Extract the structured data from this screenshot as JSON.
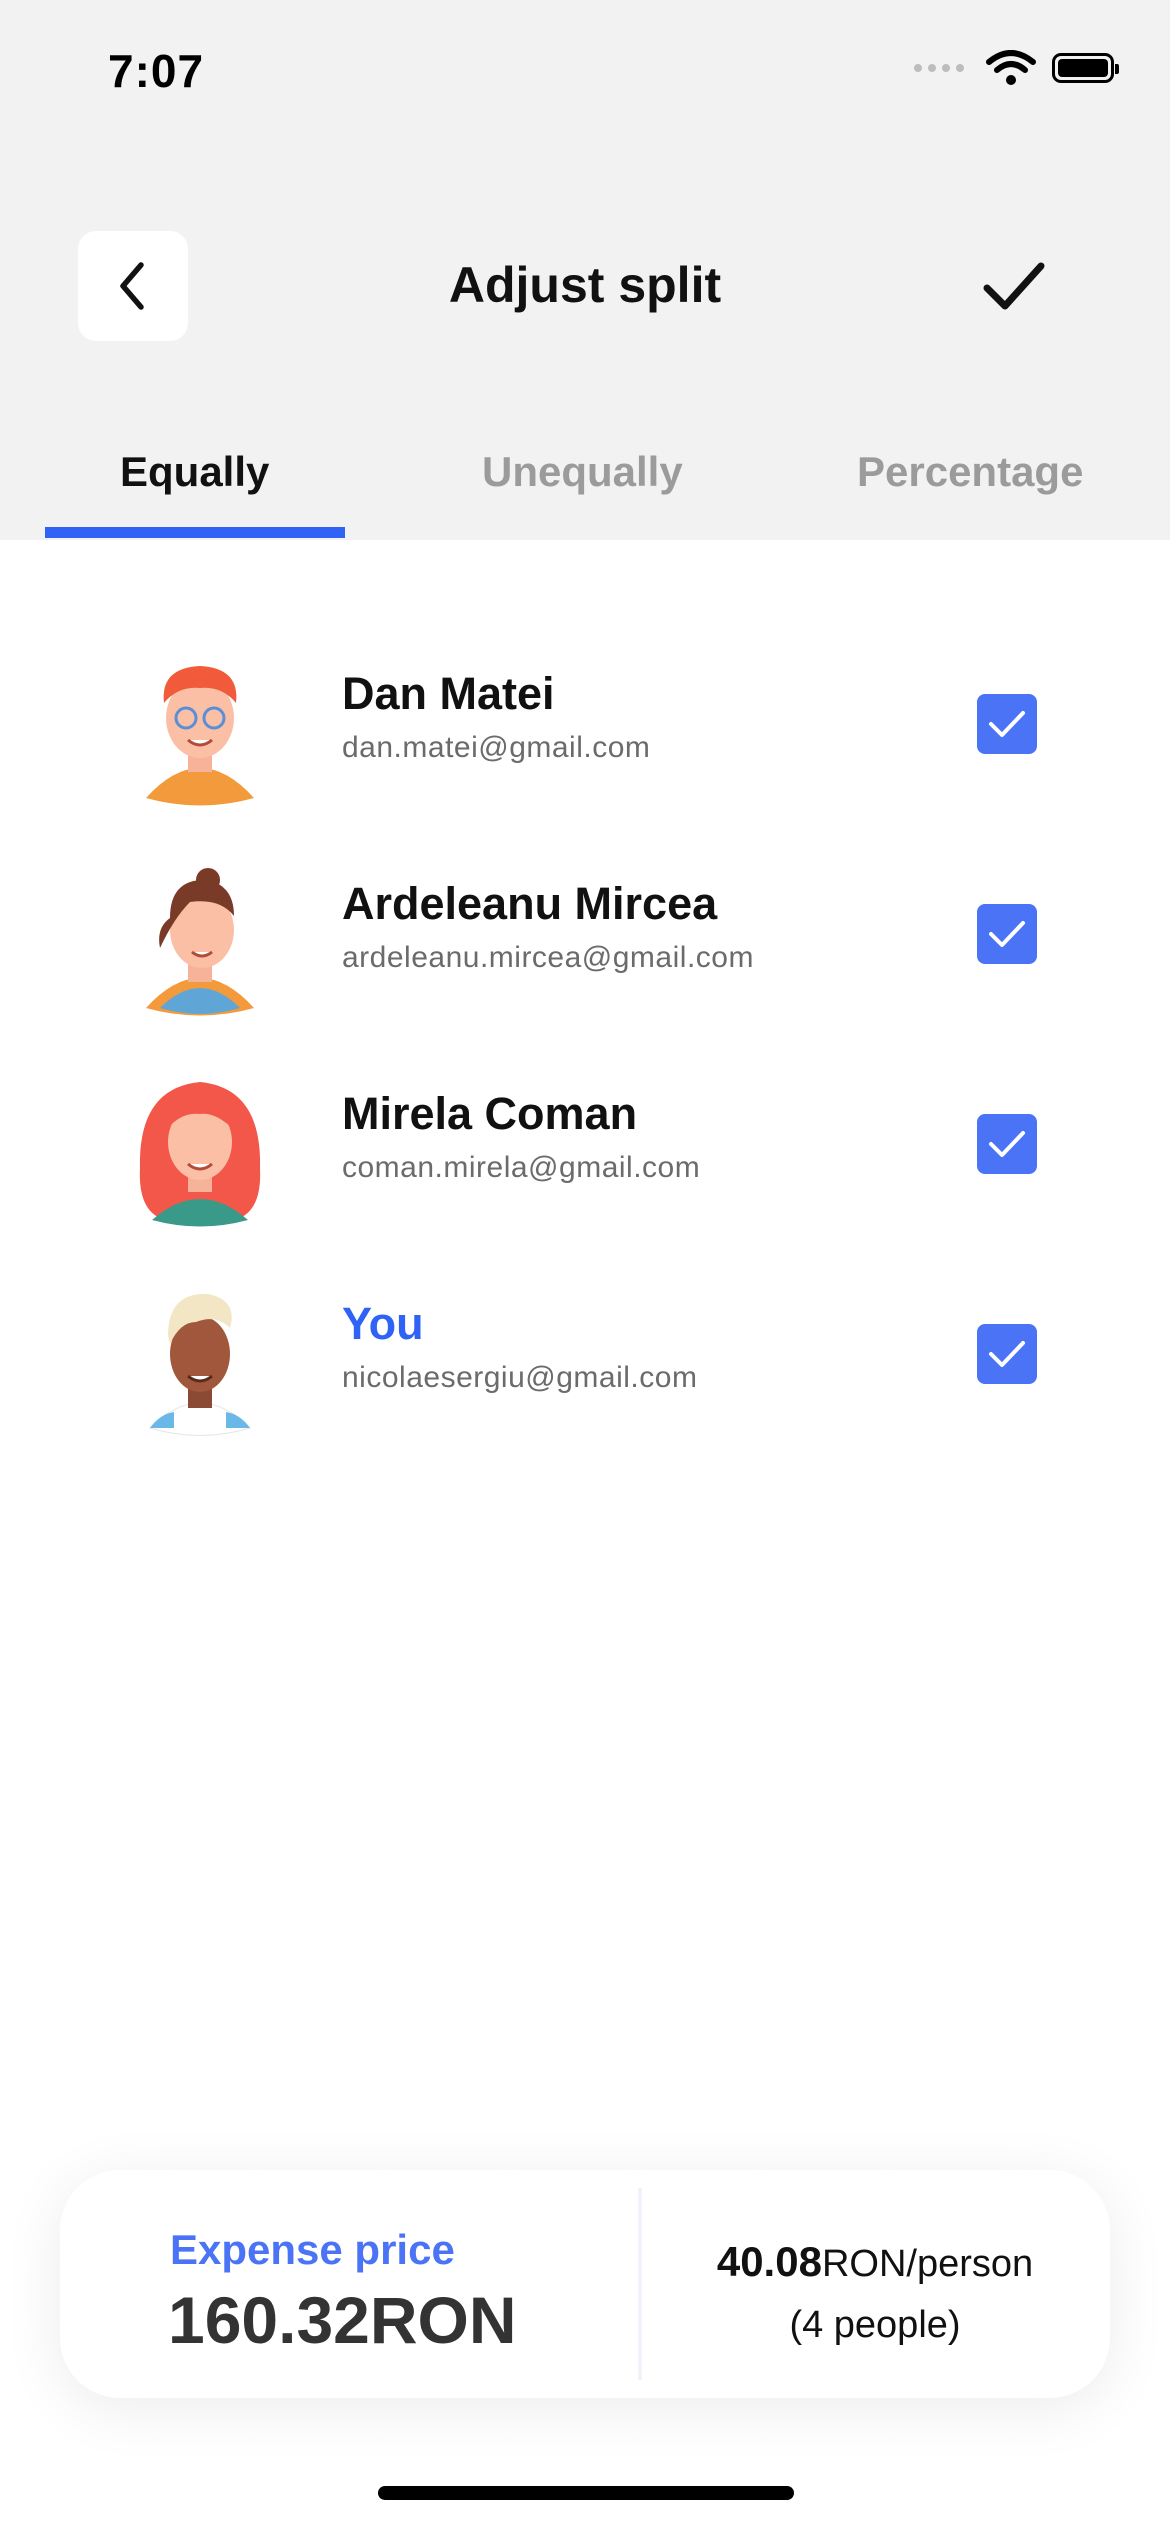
{
  "status_bar": {
    "time": "7:07"
  },
  "header": {
    "title": "Adjust split"
  },
  "tabs": [
    {
      "label": "Equally",
      "active": true
    },
    {
      "label": "Unequally",
      "active": false
    },
    {
      "label": "Percentage",
      "active": false
    }
  ],
  "people": [
    {
      "name": "Dan Matei",
      "email": "dan.matei@gmail.com",
      "checked": true
    },
    {
      "name": "Ardeleanu Mircea",
      "email": "ardeleanu.mircea@gmail.com",
      "checked": true
    },
    {
      "name": "Mirela Coman",
      "email": "coman.mirela@gmail.com",
      "checked": true
    },
    {
      "name": "You",
      "email": "nicolaesergiu@gmail.com",
      "checked": true
    }
  ],
  "summary": {
    "expense_label": "Expense price",
    "expense_total": "160.32RON",
    "per_person_amount": "40.08",
    "per_person_unit": "RON/person",
    "people_count": "(4 people)"
  },
  "colors": {
    "accent": "#2f63f5",
    "checkbox": "#4a74f5",
    "header_bg": "#f2f2f2",
    "inactive_tab": "#9b9b9b"
  }
}
